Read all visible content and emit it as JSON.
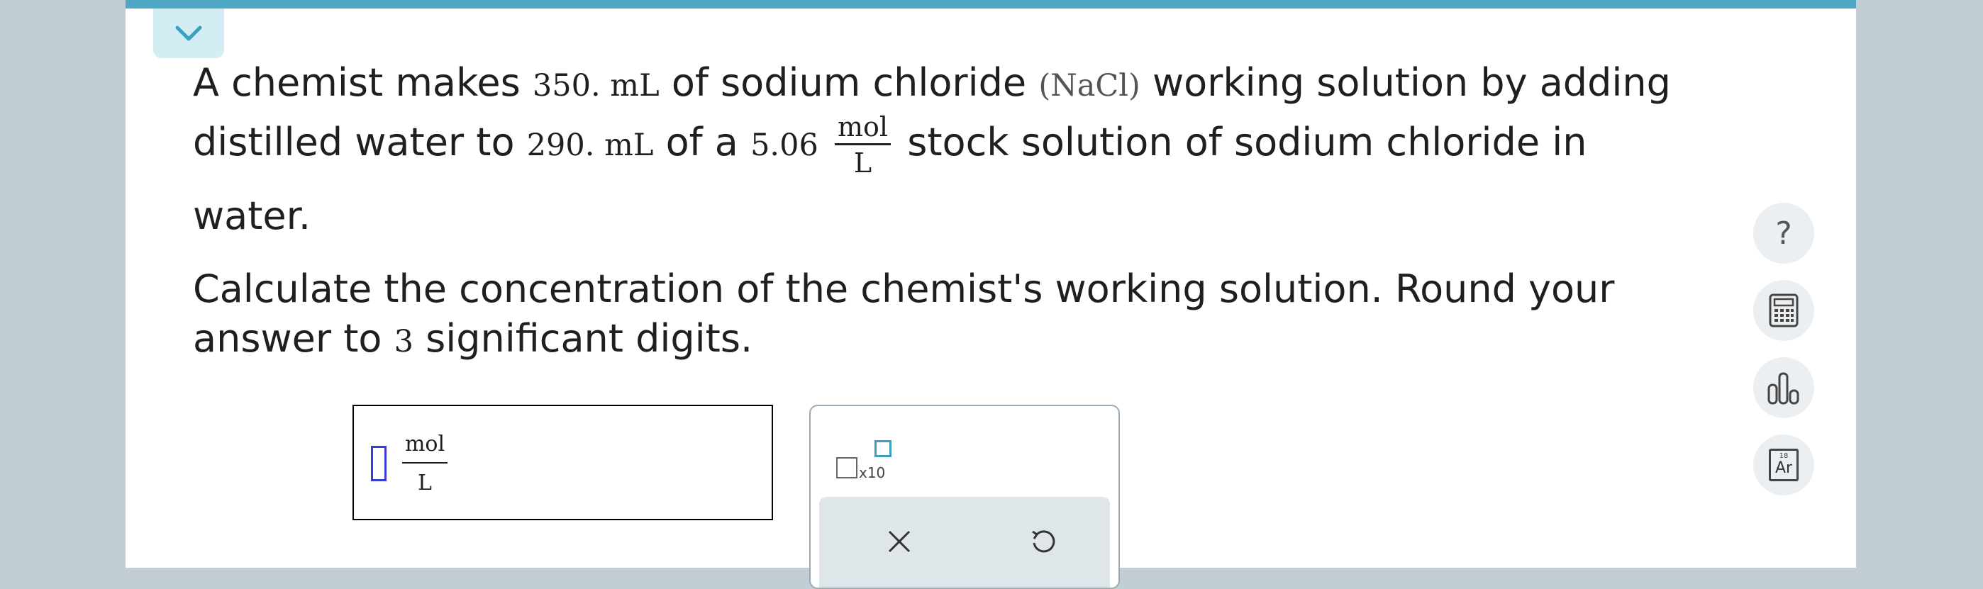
{
  "question": {
    "line1": {
      "pre": "A chemist makes",
      "volume": "350. mL",
      "mid": "of sodium chloride",
      "formula": "(NaCl)",
      "post": "working solution by adding"
    },
    "line2": {
      "pre": "distilled water to",
      "volume": "290. mL",
      "mid": "of a",
      "conc": "5.06",
      "unit_num": "mol",
      "unit_den": "L",
      "post": "stock solution of sodium chloride in"
    },
    "line3": "water.",
    "line4": "Calculate the concentration of the chemist's working solution. Round your",
    "line5": {
      "pre": "answer to",
      "digits": "3",
      "post": "significant digits."
    }
  },
  "answer": {
    "unit_num": "mol",
    "unit_den": "L",
    "value": ""
  },
  "tools": {
    "x10_label": "x10",
    "clear_icon": "close-icon",
    "undo_icon": "undo-icon"
  },
  "sidebar": {
    "help_label": "?",
    "calculator_icon": "calculator-icon",
    "data_icon": "bar-chart-icon",
    "periodic_icon": "periodic-table-icon",
    "periodic_number": "18",
    "periodic_symbol": "Ar"
  },
  "colors": {
    "top_bar": "#4ea7c4",
    "collapse_tab": "#d3edf4",
    "cursor": "#3a3ad6",
    "background": "#c3cdd4"
  }
}
